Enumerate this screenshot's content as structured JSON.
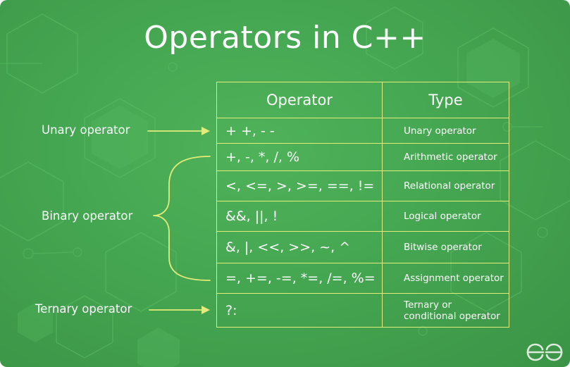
{
  "title": "Operators in C++",
  "table": {
    "headers": [
      "Operator",
      "Type"
    ],
    "rows": [
      {
        "operator": "+ +, - -",
        "type": "Unary operator"
      },
      {
        "operator": "+, -, *, /, %",
        "type": "Arithmetic operator"
      },
      {
        "operator": "<, <=, >, >=, ==, !=",
        "type": "Relational operator"
      },
      {
        "operator": "&&, ||, !",
        "type": "Logical operator"
      },
      {
        "operator": "&, |, <<, >>, ~, ^",
        "type": "Bitwise operator"
      },
      {
        "operator": "=, +=, -=, *=, /=, %=",
        "type": "Assignment operator"
      },
      {
        "operator": "?:",
        "type_line1": "Ternary or",
        "type_line2": "conditional operator"
      }
    ]
  },
  "labels": {
    "unary": "Unary operator",
    "binary": "Binary operator",
    "ternary": "Ternary operator"
  },
  "colors": {
    "background": "#45a651",
    "accent_yellow": "#e3ec7a",
    "text": "#ffffff"
  },
  "logo": {
    "icon": "gfg-logo-icon"
  }
}
